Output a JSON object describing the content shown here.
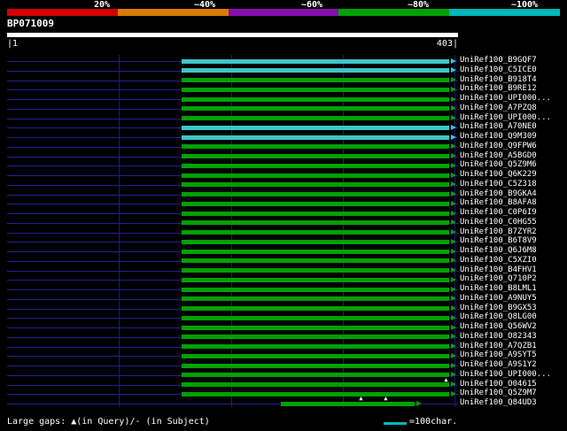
{
  "scalebar": {
    "segments": [
      {
        "label": "20%",
        "color": "#d40000"
      },
      {
        "label": "~40%",
        "color": "#d97b00"
      },
      {
        "label": "~60%",
        "color": "#8310ad"
      },
      {
        "label": "~80%",
        "color": "#00a000"
      },
      {
        "label": "~100%",
        "color": "#00b8b8"
      }
    ]
  },
  "query": {
    "name": "BP071009",
    "left_tick": "|1",
    "right_tick": "403|",
    "length": 403
  },
  "legend": {
    "gaps": "Large gaps: ▲(in Query)/- (in Subject)",
    "scale_label": "=100char.",
    "scale_color": "#00b8b8"
  },
  "chart_data": {
    "type": "bar",
    "x_range": [
      1,
      403
    ],
    "gridlines_x": [
      100,
      200,
      300,
      400
    ],
    "bar_colors": {
      "green": "#00a000",
      "cyan": "#3cc6c6"
    },
    "rows": [
      {
        "label": "UniRef100_B9GQF7",
        "color": "cyan",
        "start": 156,
        "end": 395,
        "gaps": []
      },
      {
        "label": "UniRef100_C5ICE0",
        "color": "cyan",
        "start": 156,
        "end": 395,
        "gaps": []
      },
      {
        "label": "UniRef100_B918T4",
        "color": "green",
        "start": 156,
        "end": 395,
        "gaps": []
      },
      {
        "label": "UniRef100_B9RE12",
        "color": "green",
        "start": 156,
        "end": 395,
        "gaps": []
      },
      {
        "label": "UniRef100_UPI000...",
        "color": "green",
        "start": 156,
        "end": 395,
        "gaps": []
      },
      {
        "label": "UniRef100_A7PZQ8",
        "color": "green",
        "start": 156,
        "end": 395,
        "gaps": []
      },
      {
        "label": "UniRef100_UPI000...",
        "color": "green",
        "start": 156,
        "end": 395,
        "gaps": []
      },
      {
        "label": "UniRef100_A70NE0",
        "color": "cyan",
        "start": 156,
        "end": 395,
        "gaps": []
      },
      {
        "label": "UniRef100_Q9M309",
        "color": "cyan",
        "start": 156,
        "end": 395,
        "gaps": []
      },
      {
        "label": "UniRef100_Q9FPW6",
        "color": "green",
        "start": 156,
        "end": 395,
        "gaps": []
      },
      {
        "label": "UniRef100_A5BGD0",
        "color": "green",
        "start": 156,
        "end": 395,
        "gaps": []
      },
      {
        "label": "UniRef100_Q5Z9M6",
        "color": "green",
        "start": 156,
        "end": 395,
        "gaps": []
      },
      {
        "label": "UniRef100_Q6K229",
        "color": "green",
        "start": 156,
        "end": 395,
        "gaps": []
      },
      {
        "label": "UniRef100_C5Z318",
        "color": "green",
        "start": 156,
        "end": 395,
        "gaps": []
      },
      {
        "label": "UniRef100_B9GKA4",
        "color": "green",
        "start": 156,
        "end": 395,
        "gaps": []
      },
      {
        "label": "UniRef100_B8AFA8",
        "color": "green",
        "start": 156,
        "end": 395,
        "gaps": []
      },
      {
        "label": "UniRef100_C0P6I9",
        "color": "green",
        "start": 156,
        "end": 395,
        "gaps": []
      },
      {
        "label": "UniRef100_C0HG55",
        "color": "green",
        "start": 156,
        "end": 395,
        "gaps": []
      },
      {
        "label": "UniRef100_B7ZYR2",
        "color": "green",
        "start": 156,
        "end": 395,
        "gaps": []
      },
      {
        "label": "UniRef100_B6T8V9",
        "color": "green",
        "start": 156,
        "end": 395,
        "gaps": []
      },
      {
        "label": "UniRef100_Q6J6M8",
        "color": "green",
        "start": 156,
        "end": 395,
        "gaps": []
      },
      {
        "label": "UniRef100_C5XZI0",
        "color": "green",
        "start": 156,
        "end": 395,
        "gaps": []
      },
      {
        "label": "UniRef100_B4FHV1",
        "color": "green",
        "start": 156,
        "end": 395,
        "gaps": []
      },
      {
        "label": "UniRef100_Q710P2",
        "color": "green",
        "start": 156,
        "end": 395,
        "gaps": []
      },
      {
        "label": "UniRef100_B8LML1",
        "color": "green",
        "start": 156,
        "end": 395,
        "gaps": []
      },
      {
        "label": "UniRef100_A9NUY5",
        "color": "green",
        "start": 156,
        "end": 395,
        "gaps": []
      },
      {
        "label": "UniRef100_B9GX53",
        "color": "green",
        "start": 156,
        "end": 395,
        "gaps": []
      },
      {
        "label": "UniRef100_Q8LG00",
        "color": "green",
        "start": 156,
        "end": 395,
        "gaps": []
      },
      {
        "label": "UniRef100_Q56WV2",
        "color": "green",
        "start": 156,
        "end": 395,
        "gaps": []
      },
      {
        "label": "UniRef100_O82343",
        "color": "green",
        "start": 156,
        "end": 395,
        "gaps": []
      },
      {
        "label": "UniRef100_A7QZB1",
        "color": "green",
        "start": 156,
        "end": 395,
        "gaps": []
      },
      {
        "label": "UniRef100_A9SYT5",
        "color": "green",
        "start": 156,
        "end": 395,
        "gaps": []
      },
      {
        "label": "UniRef100_A9S1Y2",
        "color": "green",
        "start": 156,
        "end": 395,
        "gaps": []
      },
      {
        "label": "UniRef100_UPI000...",
        "color": "green",
        "start": 156,
        "end": 395,
        "gaps": [
          393
        ]
      },
      {
        "label": "UniRef100_O04615",
        "color": "green",
        "start": 156,
        "end": 395,
        "gaps": []
      },
      {
        "label": "UniRef100_Q5Z9M7",
        "color": "green",
        "start": 156,
        "end": 395,
        "gaps": [
          317,
          339
        ]
      },
      {
        "label": "UniRef100_Q84UD3",
        "color": "green",
        "start": 245,
        "end": 364,
        "gaps": []
      }
    ]
  }
}
